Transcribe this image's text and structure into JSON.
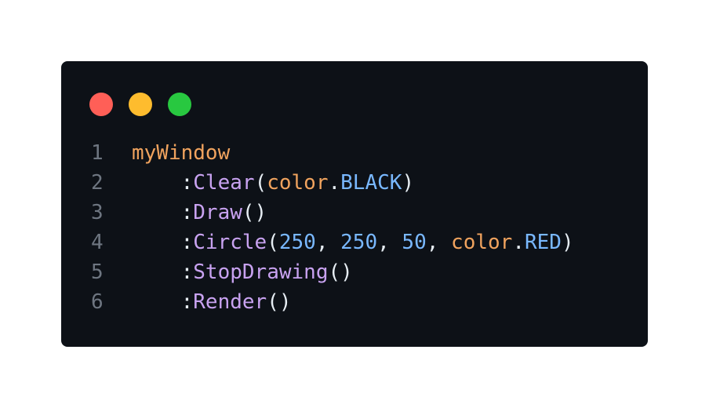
{
  "colors": {
    "window_bg": "#0d1117",
    "dot_red": "#ff5f57",
    "dot_yellow": "#febc2e",
    "dot_green": "#28c840",
    "line_number": "#6e7681",
    "identifier": "#f0a35e",
    "method": "#c8a2f0",
    "constant": "#79b8ff",
    "punctuation": "#e6edf3"
  },
  "code": {
    "lines": [
      {
        "number": "1",
        "tokens": [
          {
            "text": "myWindow",
            "kind": "identifier"
          }
        ]
      },
      {
        "number": "2",
        "tokens": [
          {
            "text": "    :",
            "kind": "punctuation"
          },
          {
            "text": "Clear",
            "kind": "method"
          },
          {
            "text": "(",
            "kind": "punctuation"
          },
          {
            "text": "color",
            "kind": "identifier"
          },
          {
            "text": ".",
            "kind": "punctuation"
          },
          {
            "text": "BLACK",
            "kind": "constant"
          },
          {
            "text": ")",
            "kind": "punctuation"
          }
        ]
      },
      {
        "number": "3",
        "tokens": [
          {
            "text": "    :",
            "kind": "punctuation"
          },
          {
            "text": "Draw",
            "kind": "method"
          },
          {
            "text": "()",
            "kind": "punctuation"
          }
        ]
      },
      {
        "number": "4",
        "tokens": [
          {
            "text": "    :",
            "kind": "punctuation"
          },
          {
            "text": "Circle",
            "kind": "method"
          },
          {
            "text": "(",
            "kind": "punctuation"
          },
          {
            "text": "250",
            "kind": "number"
          },
          {
            "text": ", ",
            "kind": "punctuation"
          },
          {
            "text": "250",
            "kind": "number"
          },
          {
            "text": ", ",
            "kind": "punctuation"
          },
          {
            "text": "50",
            "kind": "number"
          },
          {
            "text": ", ",
            "kind": "punctuation"
          },
          {
            "text": "color",
            "kind": "identifier"
          },
          {
            "text": ".",
            "kind": "punctuation"
          },
          {
            "text": "RED",
            "kind": "constant"
          },
          {
            "text": ")",
            "kind": "punctuation"
          }
        ]
      },
      {
        "number": "5",
        "tokens": [
          {
            "text": "    :",
            "kind": "punctuation"
          },
          {
            "text": "StopDrawing",
            "kind": "method"
          },
          {
            "text": "()",
            "kind": "punctuation"
          }
        ]
      },
      {
        "number": "6",
        "tokens": [
          {
            "text": "    :",
            "kind": "punctuation"
          },
          {
            "text": "Render",
            "kind": "method"
          },
          {
            "text": "()",
            "kind": "punctuation"
          }
        ]
      }
    ]
  }
}
